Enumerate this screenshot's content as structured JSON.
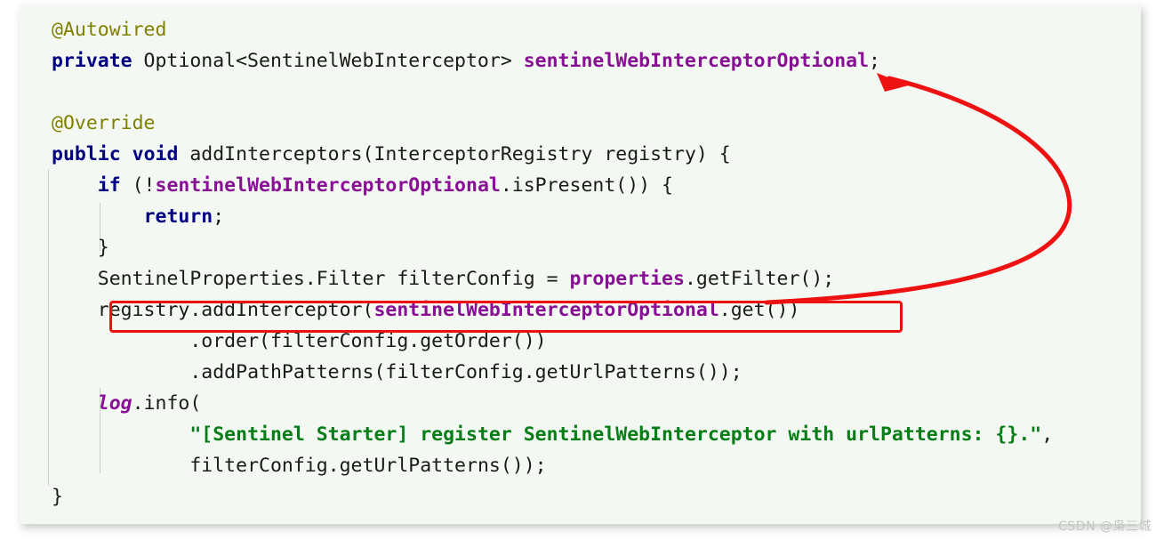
{
  "panel": {
    "background_color": "#f4f8f2",
    "language": "java"
  },
  "theme": {
    "keyword_color": "#000080",
    "annotation_color": "#808000",
    "field_color": "#871094",
    "string_color": "#067d17",
    "plain_color": "#1a1a1a",
    "guide_color": "#c9d2c6"
  },
  "code": {
    "lines": [
      {
        "indent": 0,
        "tokens": [
          {
            "t": "@Autowired",
            "c": "an"
          }
        ]
      },
      {
        "indent": 0,
        "tokens": [
          {
            "t": "private",
            "c": "k"
          },
          {
            "t": " Optional<SentinelWebInterceptor> ",
            "c": "pl"
          },
          {
            "t": "sentinelWebInterceptorOptional",
            "c": "fld"
          },
          {
            "t": ";",
            "c": "pl"
          }
        ]
      },
      {
        "indent": 0,
        "tokens": []
      },
      {
        "indent": 0,
        "tokens": [
          {
            "t": "@Override",
            "c": "an"
          }
        ]
      },
      {
        "indent": 0,
        "tokens": [
          {
            "t": "public",
            "c": "k"
          },
          {
            "t": " ",
            "c": "pl"
          },
          {
            "t": "void",
            "c": "k"
          },
          {
            "t": " addInterceptors(InterceptorRegistry registry) {",
            "c": "pl"
          }
        ]
      },
      {
        "indent": 1,
        "tokens": [
          {
            "t": "if",
            "c": "k"
          },
          {
            "t": " (!",
            "c": "pl"
          },
          {
            "t": "sentinelWebInterceptorOptional",
            "c": "fld"
          },
          {
            "t": ".isPresent()) {",
            "c": "pl"
          }
        ]
      },
      {
        "indent": 2,
        "tokens": [
          {
            "t": "return",
            "c": "k"
          },
          {
            "t": ";",
            "c": "pl"
          }
        ]
      },
      {
        "indent": 1,
        "tokens": [
          {
            "t": "}",
            "c": "pl"
          }
        ]
      },
      {
        "indent": 1,
        "tokens": [
          {
            "t": "SentinelProperties.Filter filterConfig = ",
            "c": "pl"
          },
          {
            "t": "properties",
            "c": "fld"
          },
          {
            "t": ".getFilter();",
            "c": "pl"
          }
        ]
      },
      {
        "indent": 1,
        "tokens": [
          {
            "t": "registry.addInterceptor(",
            "c": "pl"
          },
          {
            "t": "sentinelWebInterceptorOptional",
            "c": "fld"
          },
          {
            "t": ".get())",
            "c": "pl"
          }
        ]
      },
      {
        "indent": 3,
        "tokens": [
          {
            "t": ".order(filterConfig.getOrder())",
            "c": "pl"
          }
        ]
      },
      {
        "indent": 3,
        "tokens": [
          {
            "t": ".addPathPatterns(filterConfig.getUrlPatterns());",
            "c": "pl"
          }
        ]
      },
      {
        "indent": 1,
        "tokens": [
          {
            "t": "log",
            "c": "fldi"
          },
          {
            "t": ".info(",
            "c": "pl"
          }
        ]
      },
      {
        "indent": 3,
        "tokens": [
          {
            "t": "\"[Sentinel Starter] register SentinelWebInterceptor with urlPatterns: {}.\"",
            "c": "str"
          },
          {
            "t": ",",
            "c": "pl"
          }
        ]
      },
      {
        "indent": 3,
        "tokens": [
          {
            "t": "filterConfig.getUrlPatterns());",
            "c": "pl"
          }
        ]
      },
      {
        "indent": 0,
        "tokens": [
          {
            "t": "}",
            "c": "pl"
          }
        ]
      }
    ]
  },
  "annotations": {
    "highlight_box": {
      "label": "registry-addinterceptor-highlight",
      "color": "#ee1111",
      "target_line_text": "registry.addInterceptor(sentinelWebInterceptorOptional.get())"
    },
    "arrow": {
      "label": "curved-arrow-to-field-declaration",
      "color": "#ee1111",
      "from_text": "registry.addInterceptor(sentinelWebInterceptorOptional.get())",
      "to_text": "sentinelWebInterceptorOptional;"
    }
  },
  "watermark": {
    "text": "CSDN @枭三城"
  }
}
